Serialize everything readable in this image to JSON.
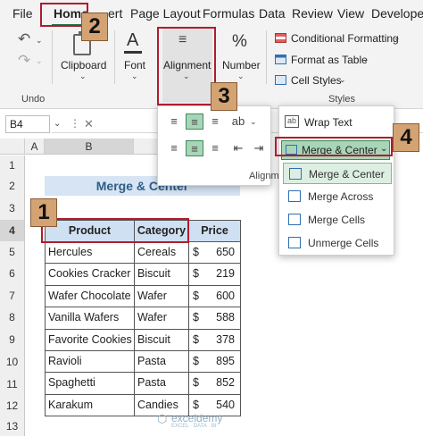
{
  "menu": {
    "tabs": [
      "File",
      "Home",
      "Insert",
      "Page Layout",
      "Formulas",
      "Data",
      "Review",
      "View",
      "Developer"
    ],
    "tab_home_visible": "Home",
    "tab_insert_visible": "ert"
  },
  "ribbon": {
    "undo_label": "Undo",
    "clipboard_label": "Clipboard",
    "font_label": "Font",
    "alignment_label": "Alignment",
    "number_label": "Number",
    "conditional_formatting": "Conditional Formatting",
    "format_as_table": "Format as Table",
    "cell_styles": "Cell Styles",
    "styles_group": "Styles",
    "alignment_group_partial": "Alignm",
    "number_symbol": "%"
  },
  "formula_bar": {
    "name_box": "B4"
  },
  "grid": {
    "columns": [
      "A",
      "B"
    ],
    "rows": [
      "1",
      "2",
      "3",
      "4",
      "5",
      "6",
      "7",
      "8",
      "9",
      "10",
      "11",
      "12",
      "13"
    ],
    "merged_title": "Merge & Center",
    "headers": [
      "Product",
      "Category",
      "Price"
    ],
    "currency": "$",
    "data": [
      [
        "Hercules",
        "Cereals",
        "650"
      ],
      [
        "Cookies Cracker",
        "Biscuit",
        "219"
      ],
      [
        "Wafer Chocolate",
        "Wafer",
        "600"
      ],
      [
        "Vanilla Wafers",
        "Wafer",
        "588"
      ],
      [
        "Favorite Cookies",
        "Biscuit",
        "378"
      ],
      [
        "Ravioli",
        "Pasta",
        "895"
      ],
      [
        "Spaghetti",
        "Pasta",
        "852"
      ],
      [
        "Karakum",
        "Candies",
        "540"
      ]
    ]
  },
  "alignment_panel": {
    "wrap_text": "Wrap Text"
  },
  "merge_menu": {
    "button": "Merge & Center",
    "items": [
      "Merge & Center",
      "Merge Across",
      "Merge Cells",
      "Unmerge Cells"
    ]
  },
  "annotations": [
    "1",
    "2",
    "3",
    "4"
  ],
  "watermark": {
    "name": "exceldemy",
    "tagline": "EXCEL · DATA · BI"
  },
  "colors": {
    "accent_green": "#1e7145",
    "annotation_red": "#b01c2e",
    "header_fill": "#cfe0f2",
    "badge_fill": "#d4a373"
  }
}
